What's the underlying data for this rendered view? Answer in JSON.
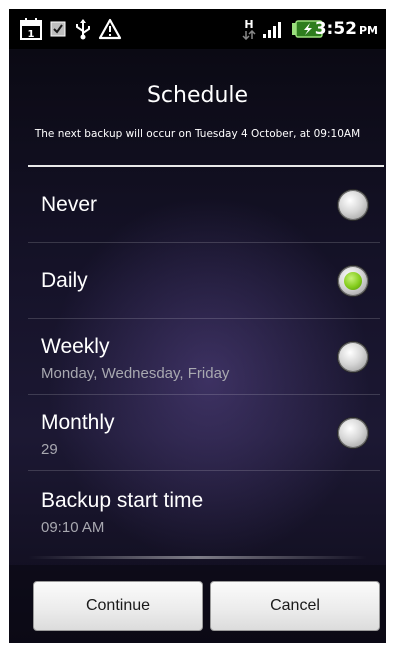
{
  "status_bar": {
    "time": "3:52",
    "ampm": "PM",
    "calendar_day": "1",
    "network_type": "H",
    "icons": [
      "calendar-icon",
      "checkbox-icon",
      "usb-icon",
      "warning-icon",
      "network-activity-icon",
      "signal-icon",
      "battery-icon"
    ]
  },
  "dialog": {
    "title": "Schedule",
    "subtitle": "The next backup will occur on Tuesday 4 October, at 09:10AM"
  },
  "options": [
    {
      "label": "Never",
      "sub": "",
      "selected": false
    },
    {
      "label": "Daily",
      "sub": "",
      "selected": true
    },
    {
      "label": "Weekly",
      "sub": "Monday, Wednesday, Friday",
      "selected": false
    },
    {
      "label": "Monthly",
      "sub": "29",
      "selected": false
    }
  ],
  "backup_start": {
    "label": "Backup start time",
    "value": "09:10 AM"
  },
  "buttons": {
    "continue": "Continue",
    "cancel": "Cancel"
  },
  "colors": {
    "radio_selected": "#84cc1c",
    "text": "#ffffff",
    "subtext": "#a8a8b0"
  }
}
